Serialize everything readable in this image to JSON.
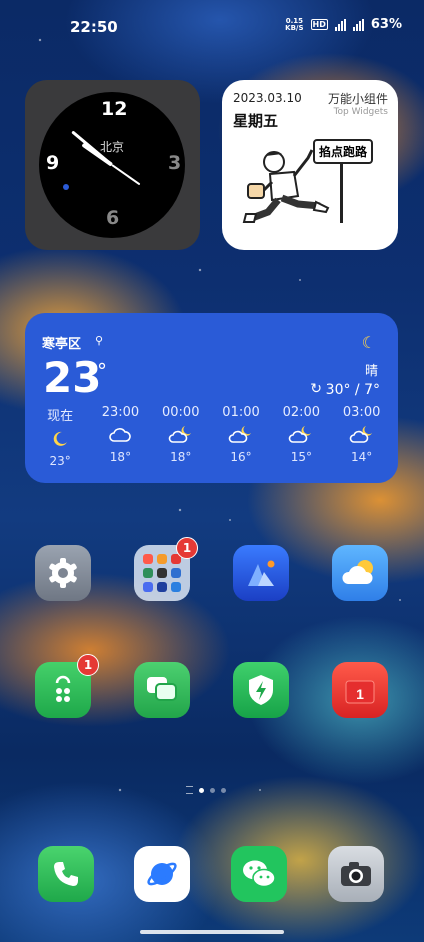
{
  "status_bar": {
    "time": "22:50",
    "net_speed_value": "0.15",
    "net_speed_unit": "KB/S",
    "hd_label": "HD",
    "battery": "63%"
  },
  "clock_widget": {
    "city": "北京",
    "numbers": {
      "twelve": "12",
      "three": "3",
      "six": "6",
      "nine": "9"
    }
  },
  "top_widgets": {
    "date": "2023.03.10",
    "weekday": "星期五",
    "brand_cn": "万能小组件",
    "brand_en": "Top Widgets",
    "sign_text": "掐点跑路"
  },
  "weather": {
    "location": "寒亭区",
    "current_temp": "23",
    "temp_unit": "°",
    "condition": "晴",
    "high_low": "30° / 7°",
    "hourly": [
      {
        "time": "现在",
        "icon": "moon-icon",
        "temp": "23°"
      },
      {
        "time": "23:00",
        "icon": "cloudy-icon",
        "temp": "18°"
      },
      {
        "time": "00:00",
        "icon": "partly-cloudy-night-icon",
        "temp": "18°"
      },
      {
        "time": "01:00",
        "icon": "partly-cloudy-night-icon",
        "temp": "16°"
      },
      {
        "time": "02:00",
        "icon": "partly-cloudy-night-icon",
        "temp": "15°"
      },
      {
        "time": "03:00",
        "icon": "partly-cloudy-night-icon",
        "temp": "14°"
      }
    ]
  },
  "apps": {
    "folder_badge": "1",
    "store_badge": "1",
    "note_badge": "1"
  },
  "colors": {
    "weather_bg": "#2a5bd7",
    "badge": "#e53935",
    "moon": "#ffd54a"
  }
}
